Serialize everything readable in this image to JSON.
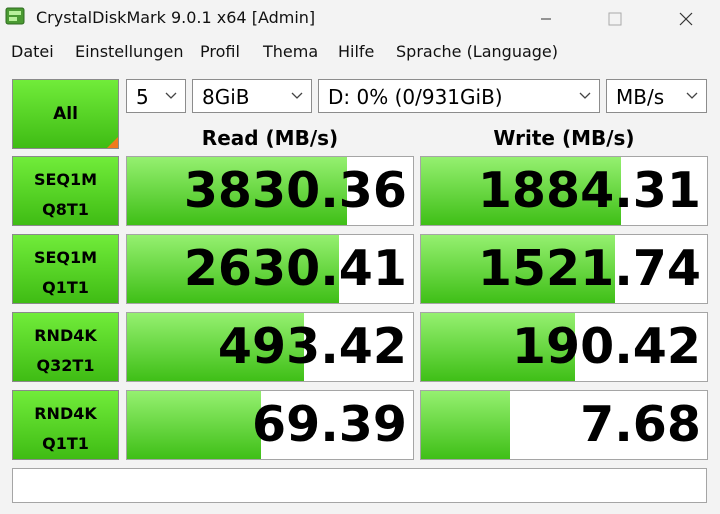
{
  "window": {
    "title": "CrystalDiskMark 9.0.1 x64 [Admin]",
    "controls": [
      "minimize",
      "maximize",
      "close"
    ]
  },
  "menu": [
    "Datei",
    "Einstellungen",
    "Profil",
    "Thema",
    "Hilfe",
    "Sprache (Language)"
  ],
  "toolbar": {
    "all_label": "All",
    "count": "5",
    "size": "8GiB",
    "drive": "D: 0% (0/931GiB)",
    "unit": "MB/s"
  },
  "headers": {
    "read": "Read (MB/s)",
    "write": "Write (MB/s)"
  },
  "rows": [
    {
      "line1": "SEQ1M",
      "line2": "Q8T1",
      "read": "3830.36",
      "write": "1884.31",
      "read_fill": 0.77,
      "write_fill": 0.7
    },
    {
      "line1": "SEQ1M",
      "line2": "Q1T1",
      "read": "2630.41",
      "write": "1521.74",
      "read_fill": 0.74,
      "write_fill": 0.68
    },
    {
      "line1": "RND4K",
      "line2": "Q32T1",
      "read": "493.42",
      "write": "190.42",
      "read_fill": 0.62,
      "write_fill": 0.54
    },
    {
      "line1": "RND4K",
      "line2": "Q1T1",
      "read": "69.39",
      "write": "7.68",
      "read_fill": 0.47,
      "write_fill": 0.31
    }
  ],
  "comment": "",
  "colors": {
    "accent_green": "#3fbc14",
    "corner_orange": "#f07a1d"
  }
}
